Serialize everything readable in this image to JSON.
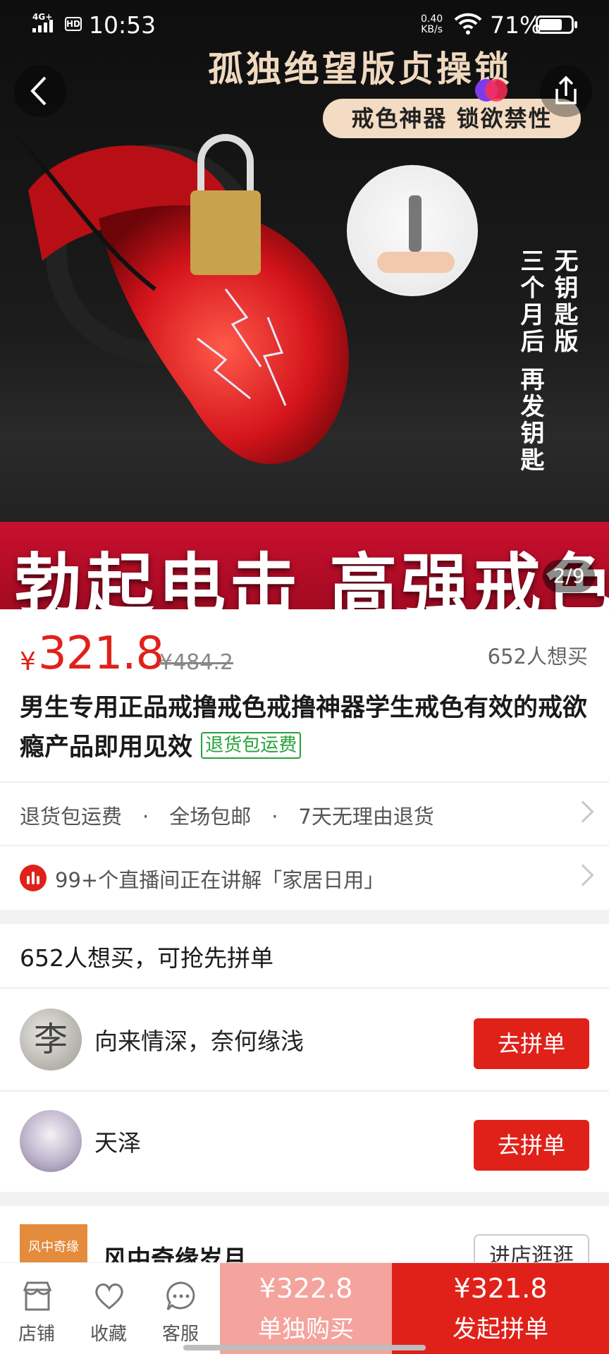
{
  "status_bar": {
    "network": "4G+",
    "hd": "HD",
    "time": "10:53",
    "speed_value": "0.40",
    "speed_unit": "KB/s",
    "battery": "71%"
  },
  "hero": {
    "headline": "孤独绝望版贞操锁",
    "subheadline": "戒色神器 锁欲禁性",
    "side_text_1": "无钥匙版",
    "side_text_2": "三个月后 再发钥匙",
    "banner": "勃起电击 高强戒色",
    "page_indicator": "2/9"
  },
  "product": {
    "currency": "¥",
    "price": "321.8",
    "original_price": "¥484.2",
    "want_count": "652人想买",
    "title": "男生专用正品戒撸戒色戒撸神器学生戒色有效的戒欲瘾产品即用见效",
    "title_tag": "退货包运费"
  },
  "services": {
    "text": "退货包运费　·　全场包邮　·　7天无理由退货"
  },
  "live": {
    "text": "99+个直播间正在讲解「家居日用」"
  },
  "group_buy": {
    "heading": "652人想买，可抢先拼单",
    "members": [
      {
        "name": "向来情深，奈何缘浅",
        "button": "去拼单"
      },
      {
        "name": "天泽",
        "button": "去拼单"
      }
    ]
  },
  "store": {
    "logo_text": "风中奇缘",
    "name": "风中奇缘岁月",
    "visit_button": "进店逛逛"
  },
  "bottom_bar": {
    "tabs": [
      "店铺",
      "收藏",
      "客服"
    ],
    "solo_price": "¥322.8",
    "solo_label": "单独购买",
    "group_price": "¥321.8",
    "group_label": "发起拼单"
  },
  "colors": {
    "accent": "#e0211a",
    "solo_button": "#f5a39d",
    "tag_green": "#26a23a"
  }
}
